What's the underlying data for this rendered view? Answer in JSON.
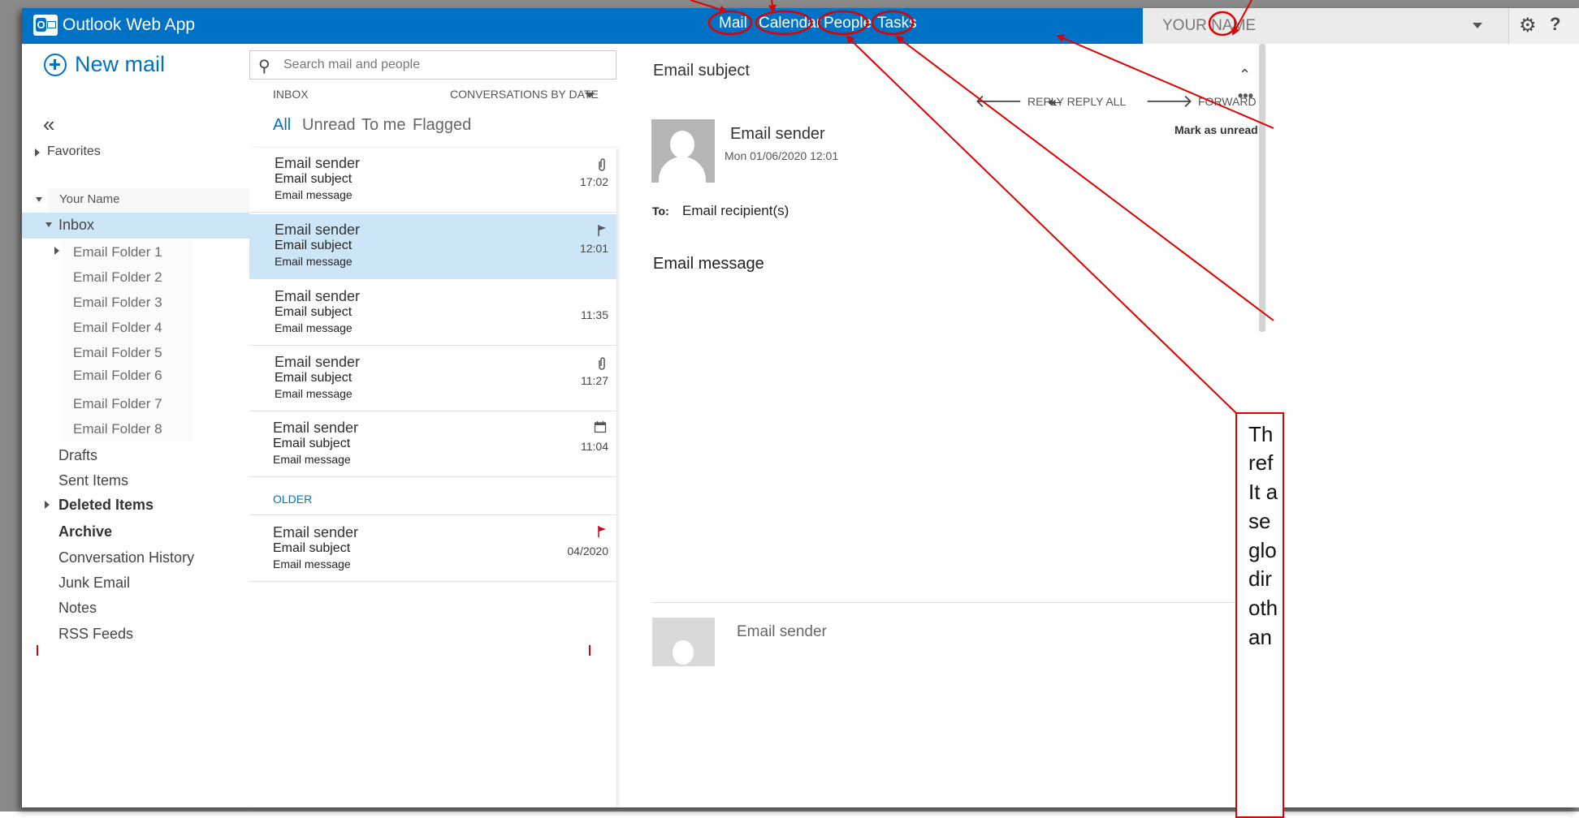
{
  "app": {
    "title": "Outlook Web App"
  },
  "nav": {
    "mail": "Mail",
    "calendar": "Calendar",
    "people": "People",
    "tasks": "Tasks"
  },
  "user": {
    "name": "YOUR NAME"
  },
  "header": {
    "help": "?"
  },
  "left": {
    "new_mail": "New mail",
    "collapse": "«",
    "favorites": "Favorites",
    "account": "Your Name",
    "inbox": "Inbox",
    "folders": [
      "Email Folder 1",
      "Email Folder 2",
      "Email Folder 3",
      "Email Folder 4",
      "Email Folder 5",
      "Email Folder 6",
      "Email Folder 7",
      "Email Folder 8"
    ],
    "drafts": "Drafts",
    "sent": "Sent Items",
    "deleted": "Deleted Items",
    "archive": "Archive",
    "conversation_history": "Conversation History",
    "junk": "Junk Email",
    "notes": "Notes",
    "rss": "RSS Feeds"
  },
  "search": {
    "placeholder": "Search mail and people"
  },
  "list": {
    "folder_label": "INBOX",
    "sort_label": "CONVERSATIONS BY DATE",
    "filters": [
      "All",
      "Unread",
      "To me",
      "Flagged"
    ],
    "older_label": "OLDER",
    "messages": [
      {
        "sender": "Email sender",
        "subject": "Email subject",
        "body": "Email message",
        "time": "17:02",
        "icon": "paperclip-icon"
      },
      {
        "sender": "Email sender",
        "subject": "Email subject",
        "body": "Email message",
        "time": "12:01",
        "icon": "flag-outline-icon"
      },
      {
        "sender": "Email sender",
        "subject": "Email subject",
        "body": "Email message",
        "time": "11:35",
        "icon": ""
      },
      {
        "sender": "Email sender",
        "subject": "Email subject",
        "body": "Email message",
        "time": "11:27",
        "icon": "paperclip-icon"
      },
      {
        "sender": "Email sender",
        "subject": "Email subject",
        "body": "Email message",
        "time": "11:04",
        "icon": "calendar-icon"
      },
      {
        "sender": "Email sender",
        "subject": "Email subject",
        "body": "Email message",
        "time": "04/2020",
        "icon": "flag-red-icon"
      }
    ]
  },
  "reading": {
    "subject": "Email subject",
    "reply": "REPLY",
    "reply_all": "REPLY ALL",
    "forward": "FORWARD",
    "sender": "Email sender",
    "date": "Mon 01/06/2020 12:01",
    "mark_unread": "Mark as unread",
    "to_label": "To:",
    "recipients": "Email recipient(s)",
    "body": "Email message",
    "thread_sender": "Email sender"
  },
  "annotation": {
    "lines": [
      "Th",
      "ref",
      "It a",
      "se",
      "glo",
      "dir",
      "oth",
      "an"
    ]
  },
  "colors": {
    "accent": "#0072c6",
    "selected": "#cde6f7",
    "annotation": "#e00000"
  }
}
